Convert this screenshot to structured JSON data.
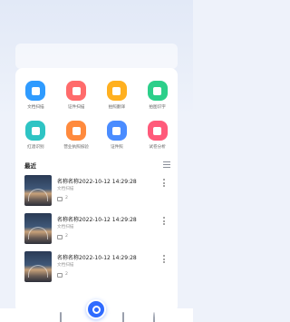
{
  "tools": [
    {
      "label": "文档扫描",
      "icon": "document-scan-icon",
      "color": "#2f9bff"
    },
    {
      "label": "证件扫描",
      "icon": "id-scan-icon",
      "color": "#ff6b6b"
    },
    {
      "label": "拍照翻译",
      "icon": "photo-translate-icon",
      "color": "#ffb020"
    },
    {
      "label": "拍图识字",
      "icon": "text-recognition-icon",
      "color": "#2ccf8a"
    },
    {
      "label": "红酒识别",
      "icon": "wine-recognition-icon",
      "color": "#2ec4c4"
    },
    {
      "label": "营业执照核验",
      "icon": "license-verify-icon",
      "color": "#ff8a3d"
    },
    {
      "label": "证件照",
      "icon": "id-photo-icon",
      "color": "#4a8cff"
    },
    {
      "label": "试卷分析",
      "icon": "exam-analysis-icon",
      "color": "#ff5a7a"
    }
  ],
  "recent": {
    "title": "最近",
    "items": [
      {
        "name": "名称名称2022-10-12 14:29:28",
        "tag": "文档扫描",
        "pages": "2"
      },
      {
        "name": "名称名称2022-10-12 14:29:28",
        "tag": "文档扫描",
        "pages": "2"
      },
      {
        "name": "名称名称2022-10-12 14:29:28",
        "tag": "文档扫描",
        "pages": "2"
      }
    ]
  },
  "colors": {
    "accent": "#2f6bff",
    "background": "#eef2fa"
  }
}
